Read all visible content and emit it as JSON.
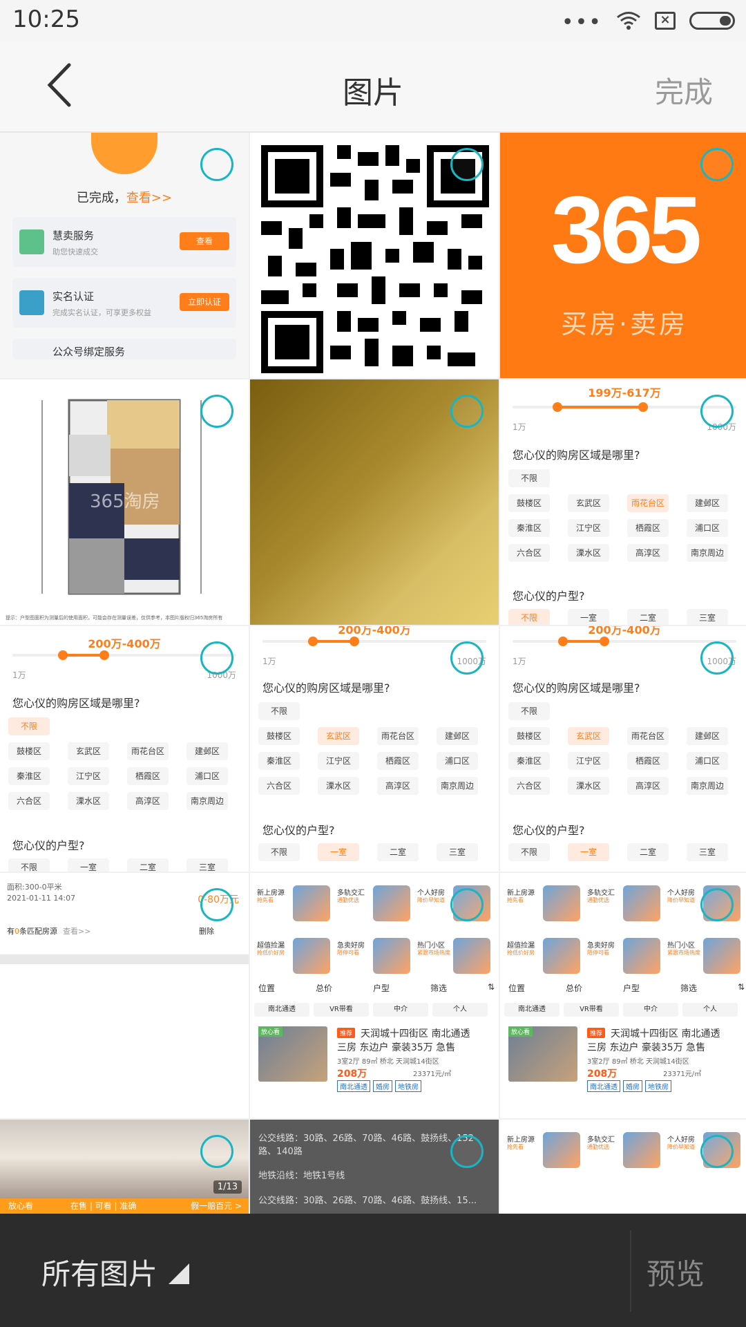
{
  "status": {
    "time": "10:25",
    "signal_icon": "wifi-icon",
    "battery_icon": "battery-icon"
  },
  "appbar": {
    "back_icon": "back-chevron-icon",
    "title": "图片",
    "done": "完成"
  },
  "grid": {
    "selection_color": "#1ab5c2",
    "accent_color": "#ff7e1a",
    "cell1": {
      "heading_prefix": "已完成，",
      "heading_link": "查看>>",
      "cards": [
        {
          "title": "慧卖服务",
          "sub": "助您快速成交",
          "btn": "查看"
        },
        {
          "title": "实名认证",
          "sub": "完成实名认证，可享更多权益",
          "btn": "立即认证"
        }
      ],
      "partial": "公众号绑定服务"
    },
    "cell3": {
      "logo": "365",
      "tagline": "买房·卖房"
    },
    "cell4": {
      "watermark": "365淘房",
      "note": "提示：户型图面积为测量后的使用面积，可能会存在测量误差，仅供参考，本图片版权归365淘房所有"
    },
    "filter1": {
      "price": "199万-617万",
      "min": "1万",
      "max": "1000万",
      "q1": "您心仪的购房区域是哪里?",
      "districts": [
        "不限",
        "鼓楼区",
        "玄武区",
        "雨花台区",
        "建邺区",
        "秦淮区",
        "江宁区",
        "栖霞区",
        "浦口区",
        "六合区",
        "溧水区",
        "高淳区",
        "南京周边"
      ],
      "q2": "您心仪的户型?",
      "rooms": [
        "不限",
        "一室",
        "二室",
        "三室"
      ]
    },
    "filter2": {
      "price": "200万-400万",
      "min": "1万",
      "max": "1000万"
    },
    "cell10": {
      "area": "面积:300-0平米",
      "date": "2021-01-11 14:07",
      "price": "0-80万元",
      "match_prefix": "有",
      "match_count": "0",
      "match_suffix": "条匹配房源",
      "view": "查看>>",
      "delete": "删除"
    },
    "services": [
      {
        "t1": "新上房源",
        "t2": "抢先看"
      },
      {
        "t1": "多轨交汇",
        "t2": "通勤优选"
      },
      {
        "t1": "个人好房",
        "t2": "降价早知道"
      },
      {
        "t1": "超值捡漏",
        "t2": "抢低价好房"
      },
      {
        "t1": "急卖好房",
        "t2": "陌停可看"
      },
      {
        "t1": "热门小区",
        "t2": "紧跟市场热度"
      }
    ],
    "tabs": [
      "位置",
      "总价",
      "户型",
      "筛选"
    ],
    "pills": [
      "南北通透",
      "VR带看",
      "中介",
      "个人"
    ],
    "listing": {
      "tag": "放心看",
      "rec": "推荐",
      "name": "天润城十四街区 南北通透",
      "name2": "三房 东边户 豪装35万 急售",
      "meta": "3室2厅 89㎡ 桥北 天润城14街区",
      "price": "208万",
      "unit_price": "23371元/㎡",
      "labels": [
        "南北通透",
        "婚房",
        "地铁房"
      ]
    },
    "room": {
      "count": "1/13",
      "brand": "放心看",
      "mid": "在售 | 可看 | 准确",
      "right": "假一赔百元 >"
    },
    "transit": {
      "bus1": "公交线路：30路、26路、70路、46路、鼓扬线、152路、140路",
      "metro": "地铁沿线：地铁1号线",
      "bus2": "公交线路：30路、26路、70路、46路、鼓扬线、15..."
    }
  },
  "bottom": {
    "album": "所有图片",
    "preview": "预览"
  }
}
